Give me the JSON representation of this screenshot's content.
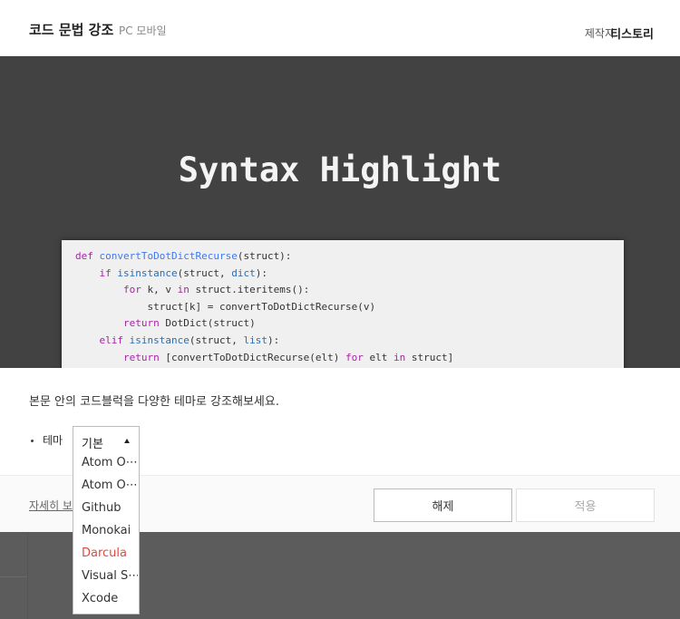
{
  "header": {
    "title": "코드 문법 강조",
    "subtitle": "PC 모바일",
    "maker_label": "제작자",
    "maker_name": "티스토리"
  },
  "hero": {
    "title": "Syntax Highlight",
    "code": [
      "def convertToDotDictRecurse(struct):",
      "    if isinstance(struct, dict):",
      "        for k, v in struct.iteritems():",
      "            struct[k] = convertToDotDictRecurse(v)",
      "        return DotDict(struct)",
      "    elif isinstance(struct, list):",
      "        return [convertToDotDictRecurse(elt) for elt in struct]"
    ]
  },
  "modal": {
    "description": "본문 안의 코드블럭을 다양한 테마로 강조해보세요.",
    "theme_label": "테마",
    "select_value": "기본",
    "options": [
      "Atom O⋯",
      "Atom O⋯",
      "Github",
      "Monokai",
      "Darcula",
      "Visual S⋯",
      "Xcode"
    ],
    "active_option": "Darcula",
    "detail_link": "자세히 보기",
    "reset_label": "해제",
    "apply_label": "적용",
    "active_color": "#e0493e"
  }
}
